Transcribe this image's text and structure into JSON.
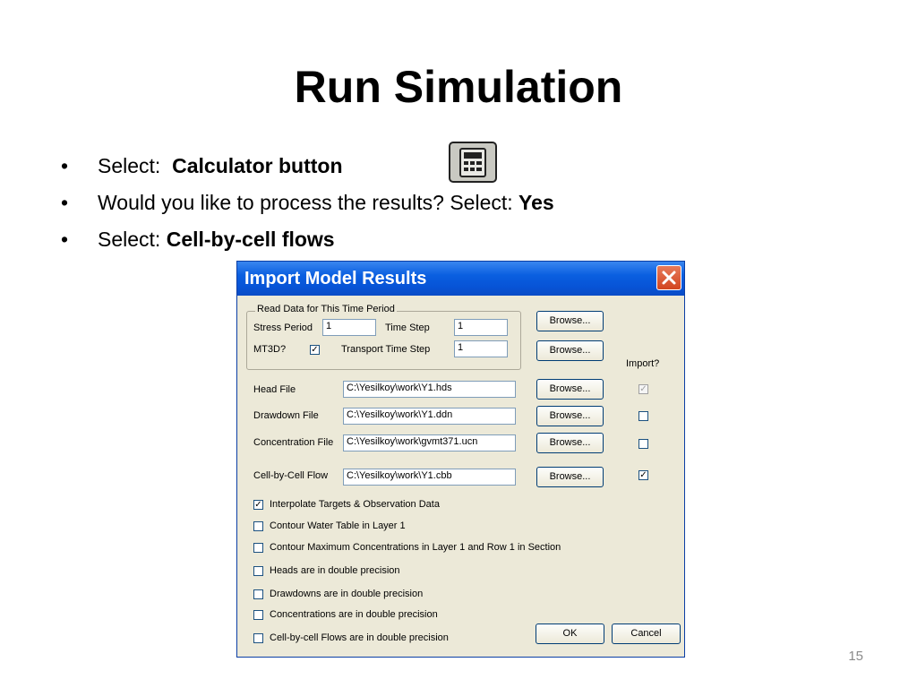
{
  "slide": {
    "title": "Run Simulation",
    "number": "15",
    "bullet_symbol": "•",
    "bullets": [
      {
        "prefix": "Select:  ",
        "bold": "Calculator button"
      },
      {
        "prefix": "Would you like to process the results? Select: ",
        "bold": "Yes"
      },
      {
        "prefix": "Select: ",
        "bold": "Cell-by-cell flows"
      }
    ],
    "calculator_icon": "calculator-icon"
  },
  "dialog": {
    "title": "Import Model Results",
    "close_icon": "close-icon",
    "group_label": "Read Data for This Time Period",
    "stress_period_label": "Stress Period",
    "stress_period_value": "1",
    "time_step_label": "Time Step",
    "time_step_value": "1",
    "mt3d_label": "MT3D?",
    "mt3d_checked": "✓",
    "transport_time_step_label": "Transport Time Step",
    "transport_time_step_value": "1",
    "browse_label": "Browse...",
    "import_header": "Import?",
    "files": [
      {
        "label": "Head File",
        "value": "C:\\Yesilkoy\\work\\Y1.hds",
        "import": "✓"
      },
      {
        "label": "Drawdown File",
        "value": "C:\\Yesilkoy\\work\\Y1.ddn",
        "import": ""
      },
      {
        "label": "Concentration File",
        "value": "C:\\Yesilkoy\\work\\gvmt371.ucn",
        "import": ""
      },
      {
        "label": "Cell-by-Cell Flow",
        "value": "C:\\Yesilkoy\\work\\Y1.cbb",
        "import": "✓"
      }
    ],
    "options": [
      {
        "label": "Interpolate Targets & Observation Data",
        "check": "✓"
      },
      {
        "label": "Contour Water Table in Layer 1",
        "check": ""
      },
      {
        "label": "Contour Maximum Concentrations in Layer 1 and Row 1 in Section",
        "check": ""
      },
      {
        "label": "Heads are in double precision",
        "check": ""
      },
      {
        "label": "Drawdowns are in double precision",
        "check": ""
      },
      {
        "label": "Concentrations are in double precision",
        "check": ""
      },
      {
        "label": "Cell-by-cell Flows are in double precision",
        "check": ""
      }
    ],
    "ok_label": "OK",
    "cancel_label": "Cancel"
  }
}
